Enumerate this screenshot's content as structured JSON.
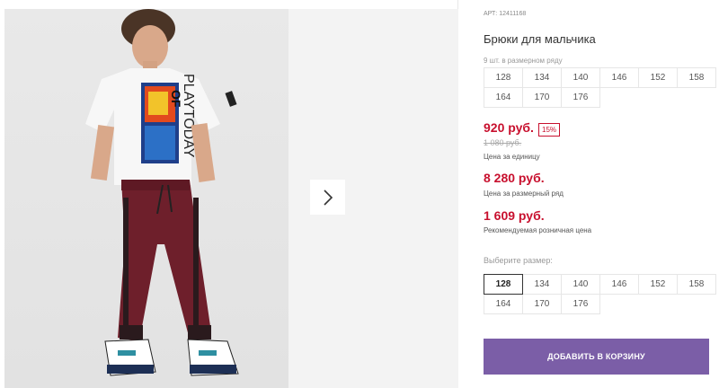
{
  "product": {
    "sku": "АРТ: 12411168",
    "title": "Брюки для мальчика",
    "pack_note": "9 шт. в размерном ряду",
    "pack_sizes": [
      "128",
      "134",
      "140",
      "146",
      "152",
      "158",
      "164",
      "170",
      "176"
    ],
    "price": "920 руб.",
    "discount": "15%",
    "old_price": "1 080 руб.",
    "price_caption": "Цена за единицу",
    "pack_price": "8 280 руб.",
    "pack_price_caption": "Цена за размерный ряд",
    "retail_price": "1 609 руб.",
    "retail_price_caption": "Рекомендуемая розничная цена"
  },
  "size_selector": {
    "label": "Выберите размер:",
    "sizes": [
      "128",
      "134",
      "140",
      "146",
      "152",
      "158",
      "164",
      "170",
      "176"
    ],
    "selected": "128"
  },
  "actions": {
    "add_to_cart": "ДОБАВИТЬ В КОРЗИНУ"
  },
  "gallery": {
    "shirt_print_text": "PLAYTODAY",
    "shirt_print_text_2": "OF",
    "next_icon": "chevron-right-icon"
  },
  "colors": {
    "price": "#c8102e",
    "button": "#7b5ea7"
  }
}
